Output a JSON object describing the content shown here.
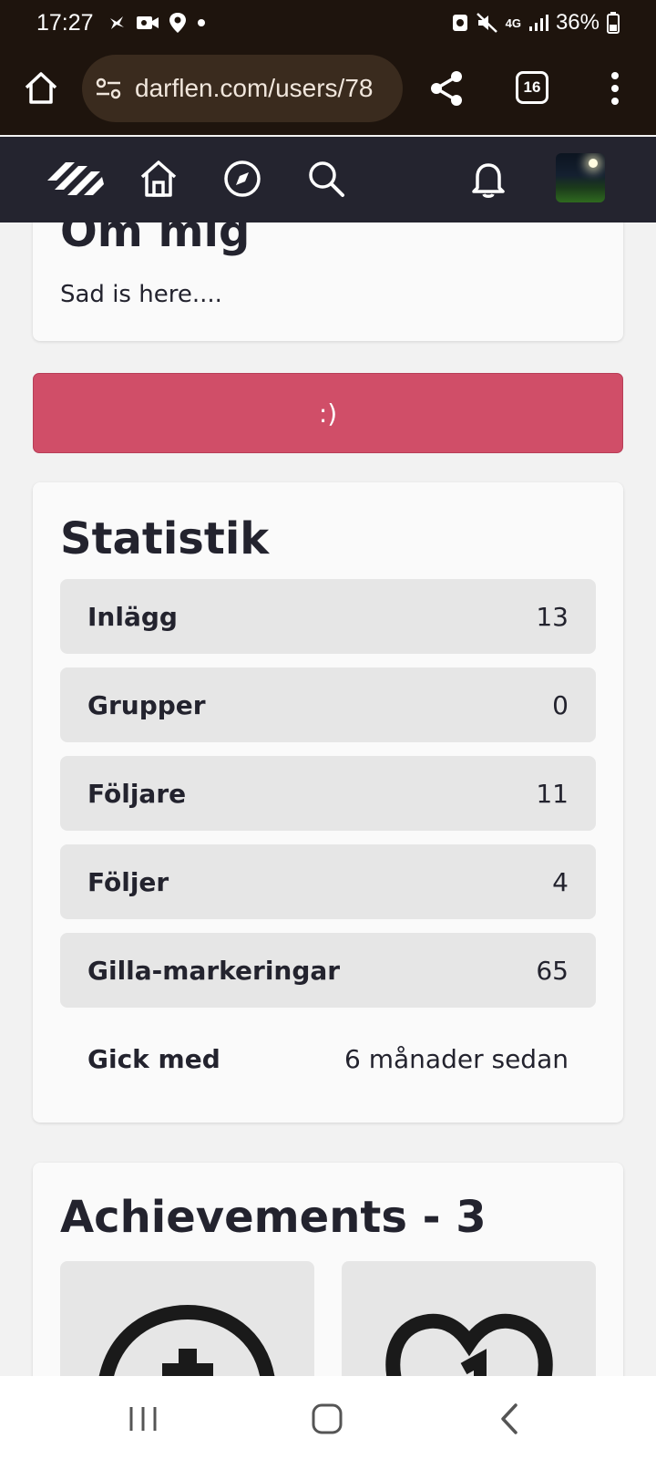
{
  "status_bar": {
    "time": "17:27",
    "network": "4G",
    "battery": "36%"
  },
  "browser": {
    "url": "darflen.com/users/78",
    "tab_count": "16"
  },
  "about": {
    "title": "Om mig",
    "text": "Sad is here...."
  },
  "mood_button": {
    "label": ":)"
  },
  "stats": {
    "title": "Statistik",
    "rows": [
      {
        "label": "Inlägg",
        "value": "13"
      },
      {
        "label": "Grupper",
        "value": "0"
      },
      {
        "label": "Följare",
        "value": "11"
      },
      {
        "label": "Följer",
        "value": "4"
      },
      {
        "label": "Gilla-markeringar",
        "value": "65"
      },
      {
        "label": "Gick med",
        "value": "6 månader sedan"
      }
    ]
  },
  "achievements": {
    "title": "Achievements - 3"
  },
  "colors": {
    "status_bg": "#1e140d",
    "nav_bg": "#24242f",
    "accent_button": "#d04e68",
    "card_bg": "#fafafa",
    "row_bg": "#e6e6e6"
  }
}
